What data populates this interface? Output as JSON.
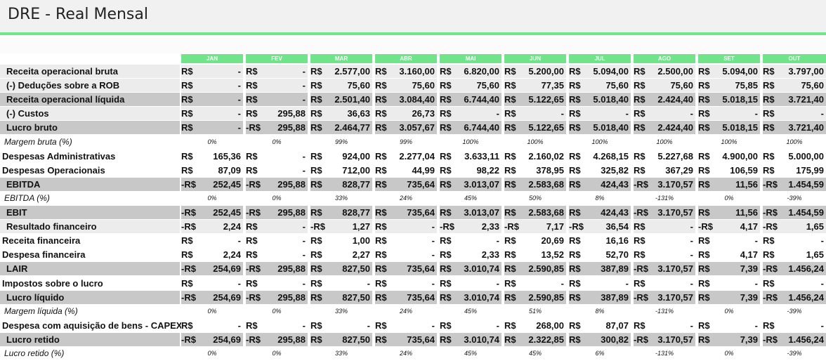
{
  "title": "DRE - Real Mensal",
  "months": [
    "JAN",
    "FEV",
    "MAR",
    "ABR",
    "MAI",
    "JUN",
    "JUL",
    "AGO",
    "SET",
    "OUT"
  ],
  "rows": [
    {
      "label": "Receita operacional bruta",
      "style": "gray",
      "indent": true,
      "cells": [
        [
          "R$",
          "-"
        ],
        [
          "R$",
          "-"
        ],
        [
          "R$",
          "2.577,00"
        ],
        [
          "R$",
          "3.160,00"
        ],
        [
          "R$",
          "6.820,00"
        ],
        [
          "R$",
          "5.200,00"
        ],
        [
          "R$",
          "5.094,00"
        ],
        [
          "R$",
          "2.500,00"
        ],
        [
          "R$",
          "5.094,00"
        ],
        [
          "R$",
          "3.797,00"
        ]
      ]
    },
    {
      "label": "(-) Deduções sobre a ROB",
      "style": "gray",
      "indent": true,
      "cells": [
        [
          "R$",
          "-"
        ],
        [
          "R$",
          "-"
        ],
        [
          "R$",
          "75,60"
        ],
        [
          "R$",
          "75,60"
        ],
        [
          "R$",
          "75,60"
        ],
        [
          "R$",
          "77,35"
        ],
        [
          "R$",
          "75,60"
        ],
        [
          "R$",
          "75,60"
        ],
        [
          "R$",
          "75,85"
        ],
        [
          "R$",
          "75,60"
        ]
      ]
    },
    {
      "label": "Receita operacional líquida",
      "style": "dark",
      "indent": true,
      "cells": [
        [
          "R$",
          "-"
        ],
        [
          "R$",
          "-"
        ],
        [
          "R$",
          "2.501,40"
        ],
        [
          "R$",
          "3.084,40"
        ],
        [
          "R$",
          "6.744,40"
        ],
        [
          "R$",
          "5.122,65"
        ],
        [
          "R$",
          "5.018,40"
        ],
        [
          "R$",
          "2.424,40"
        ],
        [
          "R$",
          "5.018,15"
        ],
        [
          "R$",
          "3.721,40"
        ]
      ]
    },
    {
      "label": "(-) Custos",
      "style": "gray",
      "indent": true,
      "cells": [
        [
          "R$",
          "-"
        ],
        [
          "R$",
          "295,88"
        ],
        [
          "R$",
          "36,63"
        ],
        [
          "R$",
          "26,73"
        ],
        [
          "R$",
          "-"
        ],
        [
          "R$",
          "-"
        ],
        [
          "R$",
          "-"
        ],
        [
          "R$",
          "-"
        ],
        [
          "R$",
          "-"
        ],
        [
          "R$",
          "-"
        ]
      ]
    },
    {
      "label": "Lucro bruto",
      "style": "dark",
      "indent": true,
      "cells": [
        [
          "R$",
          "-"
        ],
        [
          "-R$",
          "295,88"
        ],
        [
          "R$",
          "2.464,77"
        ],
        [
          "R$",
          "3.057,67"
        ],
        [
          "R$",
          "6.744,40"
        ],
        [
          "R$",
          "5.122,65"
        ],
        [
          "R$",
          "5.018,40"
        ],
        [
          "R$",
          "2.424,40"
        ],
        [
          "R$",
          "5.018,15"
        ],
        [
          "R$",
          "3.721,40"
        ]
      ]
    },
    {
      "label": "Margem bruta (%)",
      "style": "pct",
      "pcts": [
        "0%",
        "0%",
        "99%",
        "99%",
        "100%",
        "100%",
        "100%",
        "100%",
        "100%",
        "100%"
      ]
    },
    {
      "label": "Despesas Administrativas",
      "style": "white",
      "indent": false,
      "cells": [
        [
          "R$",
          "165,36"
        ],
        [
          "R$",
          "-"
        ],
        [
          "R$",
          "924,00"
        ],
        [
          "R$",
          "2.277,04"
        ],
        [
          "R$",
          "3.633,11"
        ],
        [
          "R$",
          "2.160,02"
        ],
        [
          "R$",
          "4.268,15"
        ],
        [
          "R$",
          "5.227,68"
        ],
        [
          "R$",
          "4.900,00"
        ],
        [
          "R$",
          "5.000,00"
        ]
      ]
    },
    {
      "label": "Despesas Operacionais",
      "style": "white",
      "indent": false,
      "cells": [
        [
          "R$",
          "87,09"
        ],
        [
          "R$",
          "-"
        ],
        [
          "R$",
          "712,00"
        ],
        [
          "R$",
          "44,99"
        ],
        [
          "R$",
          "98,22"
        ],
        [
          "R$",
          "378,95"
        ],
        [
          "R$",
          "325,82"
        ],
        [
          "R$",
          "367,29"
        ],
        [
          "R$",
          "106,59"
        ],
        [
          "R$",
          "175,99"
        ]
      ]
    },
    {
      "label": "EBITDA",
      "style": "dark",
      "indent": true,
      "cells": [
        [
          "-R$",
          "252,45"
        ],
        [
          "-R$",
          "295,88"
        ],
        [
          "R$",
          "828,77"
        ],
        [
          "R$",
          "735,64"
        ],
        [
          "R$",
          "3.013,07"
        ],
        [
          "R$",
          "2.583,68"
        ],
        [
          "R$",
          "424,43"
        ],
        [
          "-R$",
          "3.170,57"
        ],
        [
          "R$",
          "11,56"
        ],
        [
          "-R$",
          "1.454,59"
        ]
      ]
    },
    {
      "label": "EBITDA (%)",
      "style": "pct",
      "pcts": [
        "0%",
        "0%",
        "33%",
        "24%",
        "45%",
        "50%",
        "8%",
        "-131%",
        "0%",
        "-39%"
      ]
    },
    {
      "label": "EBIT",
      "style": "dark",
      "indent": true,
      "cells": [
        [
          "-R$",
          "252,45"
        ],
        [
          "-R$",
          "295,88"
        ],
        [
          "R$",
          "828,77"
        ],
        [
          "R$",
          "735,64"
        ],
        [
          "R$",
          "3.013,07"
        ],
        [
          "R$",
          "2.583,68"
        ],
        [
          "R$",
          "424,43"
        ],
        [
          "-R$",
          "3.170,57"
        ],
        [
          "R$",
          "11,56"
        ],
        [
          "-R$",
          "1.454,59"
        ]
      ]
    },
    {
      "label": "Resultado financeiro",
      "style": "gray",
      "indent": true,
      "cells": [
        [
          "-R$",
          "2,24"
        ],
        [
          "R$",
          "-"
        ],
        [
          "-R$",
          "1,27"
        ],
        [
          "R$",
          "-"
        ],
        [
          "-R$",
          "2,33"
        ],
        [
          "-R$",
          "7,17"
        ],
        [
          "-R$",
          "36,54"
        ],
        [
          "R$",
          "-"
        ],
        [
          "-R$",
          "4,17"
        ],
        [
          "-R$",
          "1,65"
        ]
      ]
    },
    {
      "label": "Receita financeira",
      "style": "white",
      "indent": false,
      "cells": [
        [
          "R$",
          "-"
        ],
        [
          "R$",
          "-"
        ],
        [
          "R$",
          "1,00"
        ],
        [
          "R$",
          "-"
        ],
        [
          "R$",
          "-"
        ],
        [
          "R$",
          "20,69"
        ],
        [
          "R$",
          "16,16"
        ],
        [
          "R$",
          "-"
        ],
        [
          "R$",
          "-"
        ],
        [
          "R$",
          "-"
        ]
      ]
    },
    {
      "label": "Despesa financeira",
      "style": "white",
      "indent": false,
      "cells": [
        [
          "R$",
          "2,24"
        ],
        [
          "R$",
          "-"
        ],
        [
          "R$",
          "2,27"
        ],
        [
          "R$",
          "-"
        ],
        [
          "R$",
          "2,33"
        ],
        [
          "R$",
          "13,52"
        ],
        [
          "R$",
          "52,70"
        ],
        [
          "R$",
          "-"
        ],
        [
          "R$",
          "4,17"
        ],
        [
          "R$",
          "1,65"
        ]
      ]
    },
    {
      "label": "LAIR",
      "style": "dark",
      "indent": true,
      "cells": [
        [
          "-R$",
          "254,69"
        ],
        [
          "-R$",
          "295,88"
        ],
        [
          "R$",
          "827,50"
        ],
        [
          "R$",
          "735,64"
        ],
        [
          "R$",
          "3.010,74"
        ],
        [
          "R$",
          "2.590,85"
        ],
        [
          "R$",
          "387,89"
        ],
        [
          "-R$",
          "3.170,57"
        ],
        [
          "R$",
          "7,39"
        ],
        [
          "-R$",
          "1.456,24"
        ]
      ]
    },
    {
      "label": "Impostos sobre o lucro",
      "style": "white",
      "indent": false,
      "cells": [
        [
          "R$",
          "-"
        ],
        [
          "R$",
          "-"
        ],
        [
          "R$",
          "-"
        ],
        [
          "R$",
          "-"
        ],
        [
          "R$",
          "-"
        ],
        [
          "R$",
          "-"
        ],
        [
          "R$",
          "-"
        ],
        [
          "R$",
          "-"
        ],
        [
          "R$",
          "-"
        ],
        [
          "R$",
          "-"
        ]
      ]
    },
    {
      "label": "Lucro líquido",
      "style": "dark",
      "indent": true,
      "cells": [
        [
          "-R$",
          "254,69"
        ],
        [
          "-R$",
          "295,88"
        ],
        [
          "R$",
          "827,50"
        ],
        [
          "R$",
          "735,64"
        ],
        [
          "R$",
          "3.010,74"
        ],
        [
          "R$",
          "2.590,85"
        ],
        [
          "R$",
          "387,89"
        ],
        [
          "-R$",
          "3.170,57"
        ],
        [
          "R$",
          "7,39"
        ],
        [
          "-R$",
          "1.456,24"
        ]
      ]
    },
    {
      "label": "Margem líquida (%)",
      "style": "pct",
      "pcts": [
        "0%",
        "0%",
        "33%",
        "24%",
        "45%",
        "51%",
        "8%",
        "-131%",
        "0%",
        "-39%"
      ]
    },
    {
      "label": "Despesa com aquisição de bens - CAPEX",
      "style": "white",
      "indent": false,
      "cells": [
        [
          "R$",
          "-"
        ],
        [
          "R$",
          "-"
        ],
        [
          "R$",
          "-"
        ],
        [
          "R$",
          "-"
        ],
        [
          "R$",
          "-"
        ],
        [
          "R$",
          "268,00"
        ],
        [
          "R$",
          "87,07"
        ],
        [
          "R$",
          "-"
        ],
        [
          "R$",
          "-"
        ],
        [
          "R$",
          "-"
        ]
      ]
    },
    {
      "label": "Lucro retido",
      "style": "dark",
      "indent": true,
      "cells": [
        [
          "-R$",
          "254,69"
        ],
        [
          "-R$",
          "295,88"
        ],
        [
          "R$",
          "827,50"
        ],
        [
          "R$",
          "735,64"
        ],
        [
          "R$",
          "3.010,74"
        ],
        [
          "R$",
          "2.322,85"
        ],
        [
          "R$",
          "300,82"
        ],
        [
          "-R$",
          "3.170,57"
        ],
        [
          "R$",
          "7,39"
        ],
        [
          "-R$",
          "1.456,24"
        ]
      ]
    },
    {
      "label": "Lucro retido (%)",
      "style": "pct",
      "pcts": [
        "0%",
        "0%",
        "33%",
        "24%",
        "45%",
        "45%",
        "6%",
        "-131%",
        "0%",
        "-39%"
      ]
    }
  ]
}
